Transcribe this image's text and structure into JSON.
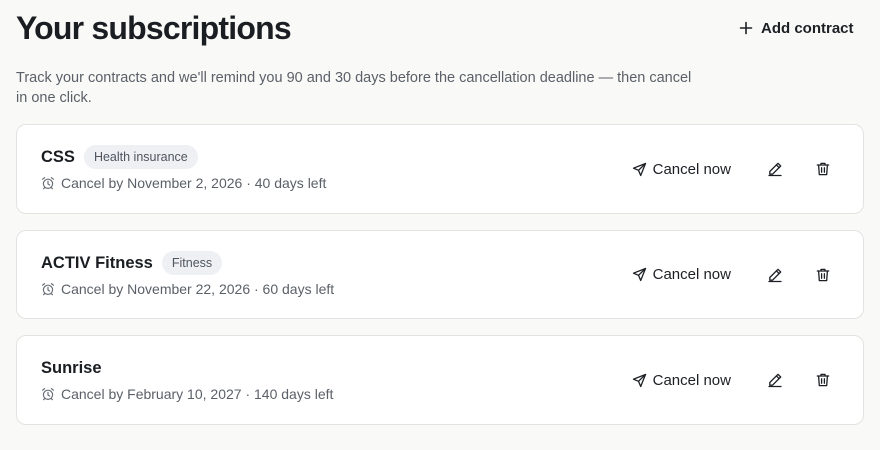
{
  "header": {
    "title": "Your subscriptions",
    "add_contract_label": "Add contract"
  },
  "intro_text": "Track your contracts and we'll remind you 90 and 30 days before the cancellation deadline — then cancel in one click.",
  "contracts": [
    {
      "name": "CSS",
      "category": "Health insurance",
      "deadline": "Cancel by November 2, 2026 · 40 days left",
      "cancel_label": "Cancel now"
    },
    {
      "name": "ACTIV Fitness",
      "category": "Fitness",
      "deadline": "Cancel by November 22, 2026 · 60 days left",
      "cancel_label": "Cancel now"
    },
    {
      "name": "Sunrise",
      "category": "",
      "deadline": "Cancel by February 10, 2027 · 140 days left",
      "cancel_label": "Cancel now"
    }
  ],
  "icons": {
    "add": "plus-icon",
    "deadline": "alarm-clock-icon",
    "cancel": "send-icon",
    "edit": "pencil-icon",
    "delete": "trash-icon"
  },
  "colors": {
    "background": "#f9f9f7",
    "card": "#ffffff",
    "card_border": "#e3e4e2",
    "text": "#1c1f24",
    "muted_text": "#5b6068",
    "badge_bg": "#eef0f3"
  }
}
